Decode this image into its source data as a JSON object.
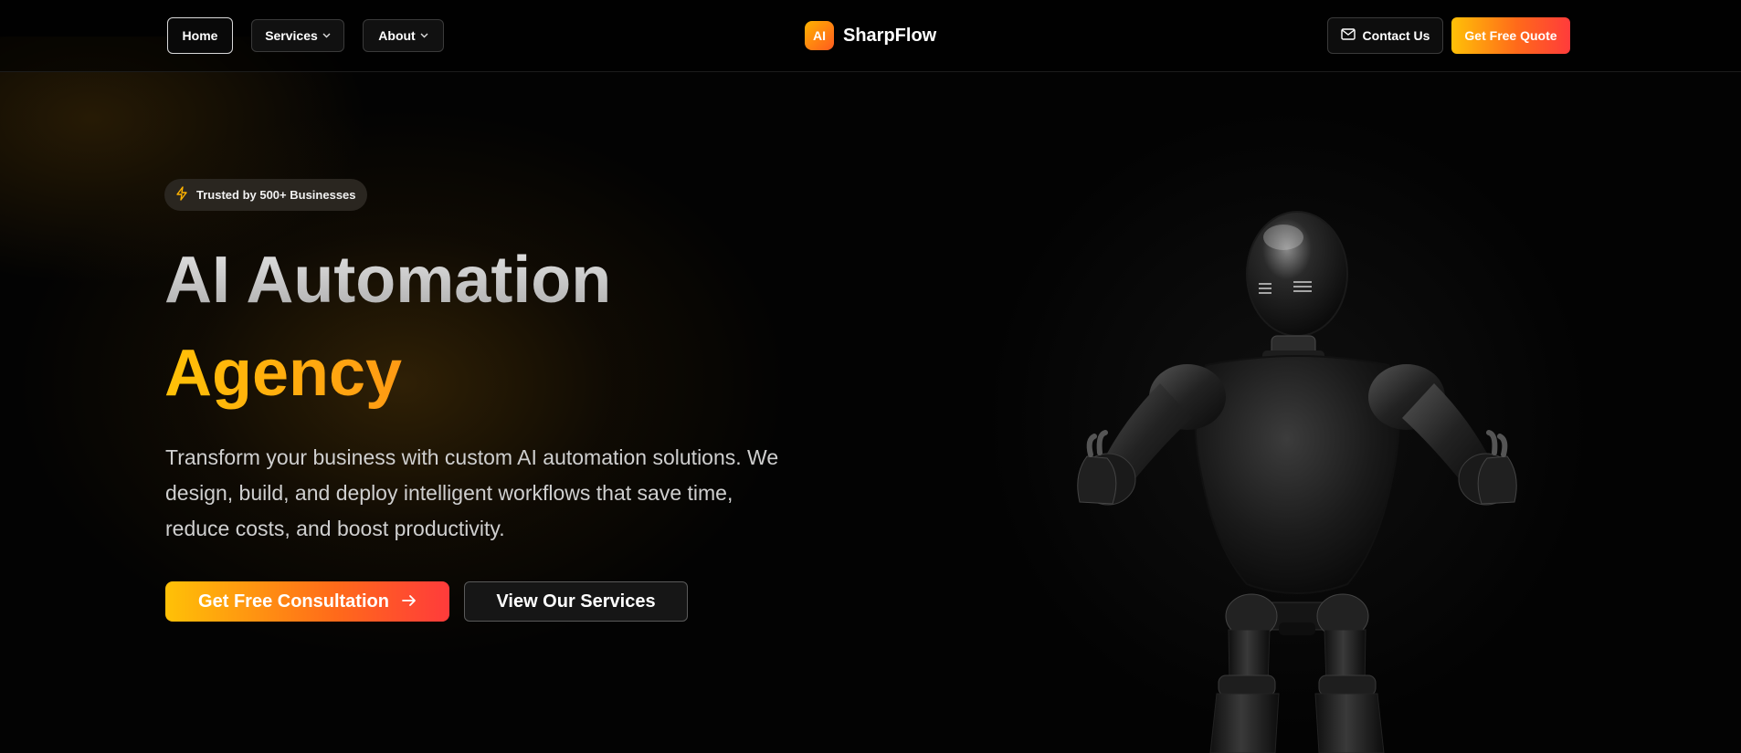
{
  "nav": {
    "home_label": "Home",
    "services_label": "Services",
    "about_label": "About",
    "chevron_icon": "chevron-down-icon"
  },
  "brand": {
    "badge_text": "AI",
    "name": "SharpFlow",
    "accent_start": "#ffc107",
    "accent_end": "#ff3b3b"
  },
  "actions": {
    "contact_label": "Contact Us",
    "contact_icon": "mail-icon",
    "quote_label": "Get Free Quote"
  },
  "hero": {
    "badge_text": "Trusted by 500+ Businesses",
    "badge_icon": "lightning-icon",
    "title_line1": "AI Automation",
    "title_line2": "Agency",
    "description": "Transform your business with custom AI automation solutions. We design, build, and deploy intelligent workflows that save time, reduce costs, and boost productivity.",
    "primary_cta": "Get Free Consultation",
    "primary_cta_icon": "arrow-right-icon",
    "secondary_cta": "View Our Services"
  }
}
